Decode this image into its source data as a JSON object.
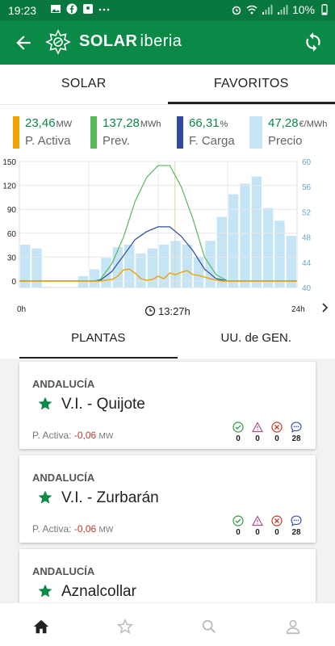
{
  "status_bar": {
    "time": "19:23",
    "battery": "10%"
  },
  "app_bar": {
    "brand_bold": "SOLAR",
    "brand_light": "iberia"
  },
  "top_tabs": [
    {
      "label": "SOLAR"
    },
    {
      "label": "FAVORITOS"
    }
  ],
  "kpis": [
    {
      "value": "23,46",
      "unit": "MW",
      "label": "P. Activa",
      "color": "#f3a200"
    },
    {
      "value": "137,28",
      "unit": "MWh",
      "label": "Prev.",
      "color": "#58b85c"
    },
    {
      "value": "66,31",
      "unit": "%",
      "label": "F. Carga",
      "color": "#2e4aa6"
    },
    {
      "value": "47,28",
      "unit": "€/MWh",
      "label": "Precio",
      "color": "#c5e4f5"
    }
  ],
  "chart": {
    "time_label": "13:27h",
    "x_start": "0h",
    "x_end": "24h",
    "left_ticks": [
      "150",
      "120",
      "90",
      "60",
      "30",
      "0"
    ],
    "right_ticks": [
      "60",
      "56",
      "52",
      "48",
      "44",
      "40"
    ]
  },
  "chart_data": {
    "type": "bar",
    "x": [
      0,
      1,
      2,
      3,
      4,
      5,
      6,
      7,
      8,
      9,
      10,
      11,
      12,
      13,
      14,
      15,
      16,
      17,
      18,
      19,
      20,
      21,
      22,
      23
    ],
    "xlim": [
      0,
      24
    ],
    "ylim_left": [
      0,
      150
    ],
    "ylim_right": [
      40,
      60
    ],
    "price_bars": [
      46.8,
      46.2,
      40.1,
      38.6,
      38.4,
      41.8,
      42.9,
      44.7,
      46.4,
      46.8,
      45.4,
      46.2,
      46.8,
      47.4,
      46.8,
      44.8,
      47.4,
      51.2,
      54.8,
      56.5,
      57.6,
      52.6,
      50.6,
      48.2
    ],
    "series": [
      {
        "name": "Prev.",
        "color": "#58b85c",
        "x": [
          0,
          4,
          6.5,
          7,
          8,
          9,
          10,
          11,
          12,
          13,
          14,
          15,
          16,
          17,
          18,
          19,
          20,
          24
        ],
        "y": [
          0,
          0,
          0,
          2,
          22,
          55,
          100,
          130,
          145,
          145,
          118,
          78,
          30,
          8,
          0,
          0,
          0,
          0
        ]
      },
      {
        "name": "F. Carga",
        "color": "#2e4aa6",
        "x": [
          0,
          4,
          6.5,
          7,
          8,
          9,
          10,
          11,
          12,
          13,
          14,
          15,
          16,
          17,
          18,
          19,
          20,
          24
        ],
        "y": [
          0,
          0,
          0,
          1,
          12,
          32,
          52,
          62,
          68,
          68,
          56,
          38,
          15,
          3,
          0,
          0,
          0,
          0
        ]
      },
      {
        "name": "P. Activa",
        "color": "#f3a200",
        "x": [
          0,
          4,
          7,
          8,
          8.5,
          9,
          9.5,
          10,
          10.5,
          11,
          11.5,
          12,
          12.5,
          13,
          13.5,
          14,
          14.5,
          15,
          15.5,
          16,
          17,
          17.5,
          18,
          24
        ],
        "y": [
          0,
          0,
          0,
          2,
          6,
          14,
          15,
          10,
          3,
          1,
          2,
          6,
          3,
          10,
          8,
          11,
          13,
          8,
          7,
          5,
          1,
          0,
          0,
          0
        ]
      }
    ]
  },
  "list_tabs": [
    {
      "label": "PLANTAS"
    },
    {
      "label": "UU. de GEN."
    }
  ],
  "cards": [
    {
      "region": "ANDALUCÍA",
      "name": "V.I. - Quijote",
      "power_label": "P. Activa:",
      "power_value": "-0,06",
      "power_unit": "MW",
      "ok": "0",
      "warning": "0",
      "error": "0",
      "info": "28"
    },
    {
      "region": "ANDALUCÍA",
      "name": "V.I. - Zurbarán",
      "power_label": "P. Activa:",
      "power_value": "-0,06",
      "power_unit": "MW",
      "ok": "0",
      "warning": "0",
      "error": "0",
      "info": "28"
    },
    {
      "region": "ANDALUCÍA",
      "name": "Aznalcollar"
    }
  ],
  "colors": {
    "brand_green": "#0b8a47",
    "status_green": "#08783e",
    "star_green": "#0b8a47"
  },
  "icons": {
    "back": "arrow-left-icon",
    "refresh": "refresh-icon",
    "nav": [
      "home-icon",
      "star-icon",
      "search-icon",
      "user-icon"
    ]
  }
}
